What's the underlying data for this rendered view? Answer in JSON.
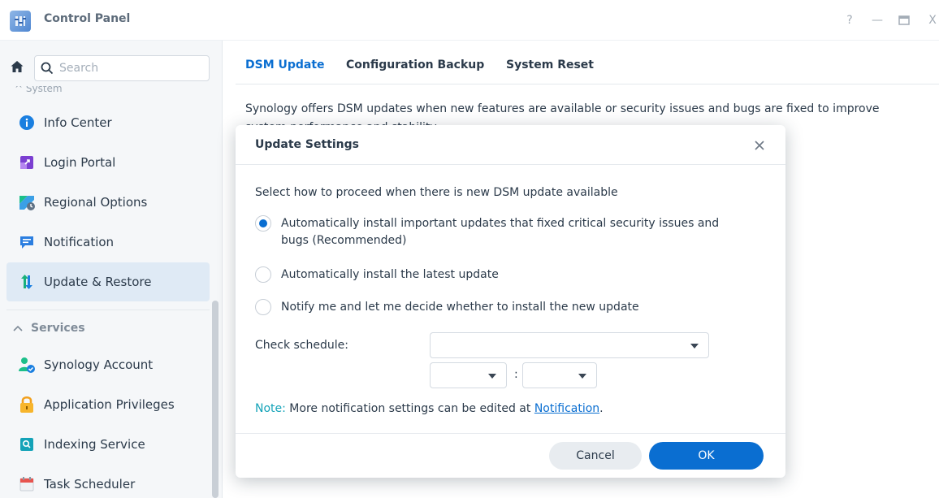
{
  "window": {
    "title": "Control Panel",
    "help": "?",
    "minimize": "—",
    "close": "X"
  },
  "sidebar": {
    "search_placeholder": "Search",
    "cut_label": "^ System",
    "section_services": "Services",
    "items": [
      {
        "label": "Info Center",
        "icon": "info-icon"
      },
      {
        "label": "Login Portal",
        "icon": "login-portal-icon"
      },
      {
        "label": "Regional Options",
        "icon": "regional-options-icon"
      },
      {
        "label": "Notification",
        "icon": "notification-icon"
      },
      {
        "label": "Update & Restore",
        "icon": "update-restore-icon",
        "active": true
      },
      {
        "label": "Synology Account",
        "icon": "synology-account-icon"
      },
      {
        "label": "Application Privileges",
        "icon": "lock-icon"
      },
      {
        "label": "Indexing Service",
        "icon": "indexing-service-icon"
      },
      {
        "label": "Task Scheduler",
        "icon": "calendar-icon"
      }
    ]
  },
  "tabs": [
    {
      "label": "DSM Update",
      "active": true
    },
    {
      "label": "Configuration Backup"
    },
    {
      "label": "System Reset"
    }
  ],
  "main": {
    "description": "Synology offers DSM updates when new features are available or security issues and bugs are fixed to improve",
    "description_cont": "system performance and stability."
  },
  "dialog": {
    "title": "Update Settings",
    "intro": "Select how to proceed when there is new DSM update available",
    "options": [
      {
        "line1": "Automatically install important updates that fixed critical security issues and",
        "line2": "bugs (Recommended)",
        "checked": true
      },
      {
        "line1": "Automatically install the latest update",
        "checked": false
      },
      {
        "line1": "Notify me and let me decide whether to install the new update",
        "checked": false
      }
    ],
    "schedule_label": "Check schedule:",
    "schedule_value": "",
    "hour_value": "",
    "minute_value": "",
    "colon": ":",
    "note_label": "Note:",
    "note_text": " More notification settings can be edited at ",
    "note_link": "Notification",
    "note_end": ".",
    "cancel": "Cancel",
    "ok": "OK"
  },
  "colors": {
    "accent": "#0a6ed1",
    "active_item_bg": "#dfeaf5",
    "note_label": "#14a3b8"
  }
}
